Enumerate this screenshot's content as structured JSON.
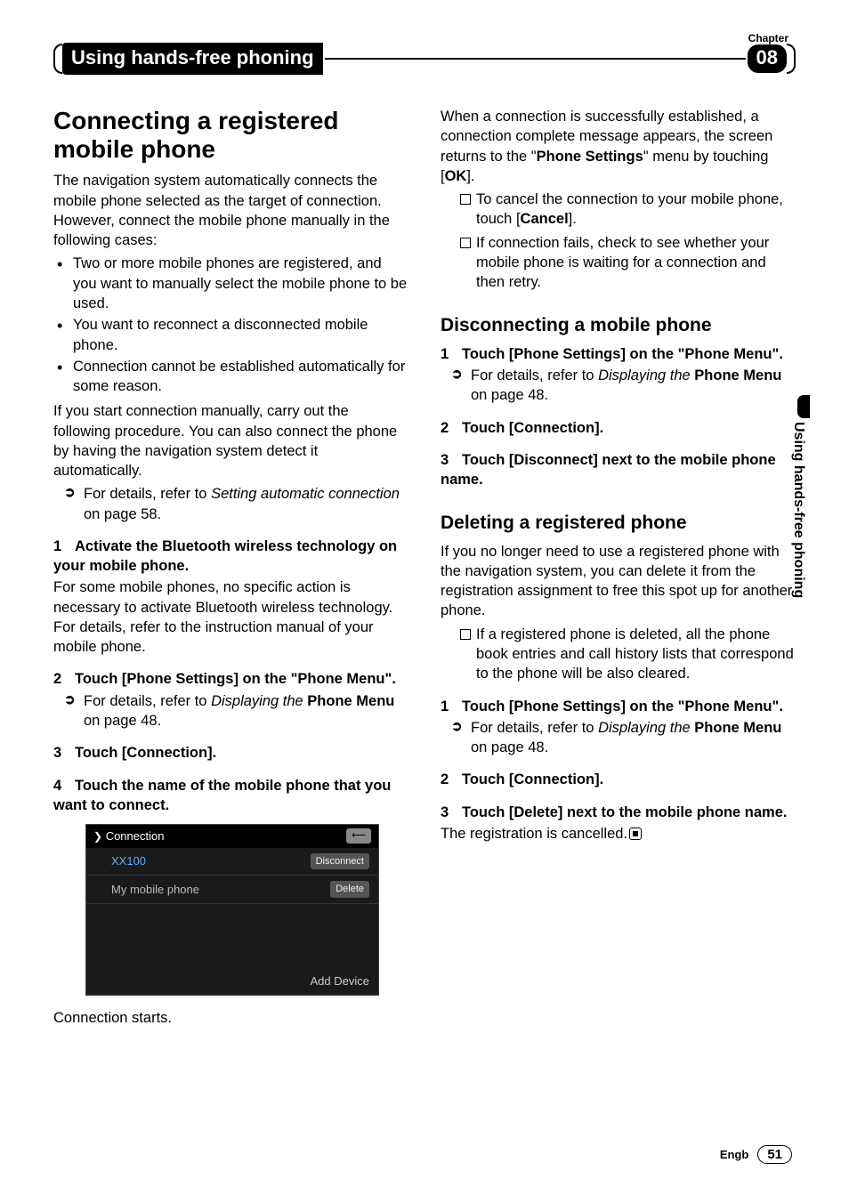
{
  "chapter": {
    "label": "Chapter",
    "number": "08"
  },
  "header": {
    "title": "Using hands-free phoning"
  },
  "side_tab": "Using hands-free phoning",
  "footer": {
    "lang": "Engb",
    "page": "51"
  },
  "left": {
    "h1": "Connecting a registered mobile phone",
    "intro": "The navigation system automatically connects the mobile phone selected as the target of connection. However, connect the mobile phone manually in the following cases:",
    "bullets": [
      "Two or more mobile phones are registered, and you want to manually select the mobile phone to be used.",
      "You want to reconnect a disconnected mobile phone.",
      "Connection cannot be established automatically for some reason."
    ],
    "after_bullets": "If you start connection manually, carry out the following procedure. You can also connect the phone by having the navigation system detect it automatically.",
    "pointer1_a": "For details, refer to ",
    "pointer1_b": "Setting automatic connection",
    "pointer1_c": " on page 58.",
    "step1": {
      "num": "1",
      "text": "Activate the Bluetooth wireless technology on your mobile phone."
    },
    "step1_body": "For some mobile phones, no specific action is necessary to activate Bluetooth wireless technology. For details, refer to the instruction manual of your mobile phone.",
    "step2": {
      "num": "2",
      "text": "Touch [Phone Settings] on the \"Phone Menu\"."
    },
    "step2_pointer_a": "For details, refer to ",
    "step2_pointer_b": "Displaying the",
    "step2_pointer_c": " Phone Menu",
    "step2_pointer_d": " on page 48.",
    "step3": {
      "num": "3",
      "text": "Touch [Connection]."
    },
    "step4": {
      "num": "4",
      "text": "Touch the name of the mobile phone that you want to connect."
    },
    "shot": {
      "title": "Connection",
      "back": "⟵",
      "row1": {
        "name": "XX100",
        "btn": "Disconnect"
      },
      "row2": {
        "name": "My mobile phone",
        "btn": "Delete"
      },
      "footer": "Add Device"
    },
    "after_shot": "Connection starts."
  },
  "right": {
    "top_para_a": "When a connection is successfully established, a connection complete message appears, the screen returns to the \"",
    "top_para_b": "Phone Settings",
    "top_para_c": "\" menu by touching [",
    "top_para_d": "OK",
    "top_para_e": "].",
    "box1_a": "To cancel the connection to your mobile phone, touch [",
    "box1_b": "Cancel",
    "box1_c": "].",
    "box2": "If connection fails, check to see whether your mobile phone is waiting for a connection and then retry.",
    "h2a": "Disconnecting a mobile phone",
    "a_step1": {
      "num": "1",
      "text": "Touch [Phone Settings] on the \"Phone Menu\"."
    },
    "a_ptr_a": "For details, refer to ",
    "a_ptr_b": "Displaying the",
    "a_ptr_c": " Phone Menu",
    "a_ptr_d": " on page 48.",
    "a_step2": {
      "num": "2",
      "text": "Touch [Connection]."
    },
    "a_step3": {
      "num": "3",
      "text": "Touch [Disconnect] next to the mobile phone name."
    },
    "h2b": "Deleting a registered phone",
    "b_intro": "If you no longer need to use a registered phone with the navigation system, you can delete it from the registration assignment to free this spot up for another phone.",
    "b_box": "If a registered phone is deleted, all the phone book entries and call history lists that correspond to the phone will be also cleared.",
    "b_step1": {
      "num": "1",
      "text": "Touch [Phone Settings] on the \"Phone Menu\"."
    },
    "b_ptr_a": "For details, refer to ",
    "b_ptr_b": "Displaying the",
    "b_ptr_c": " Phone Menu",
    "b_ptr_d": " on page 48.",
    "b_step2": {
      "num": "2",
      "text": "Touch [Connection]."
    },
    "b_step3": {
      "num": "3",
      "text": "Touch [Delete] next to the mobile phone name."
    },
    "b_end": "The registration is cancelled."
  }
}
